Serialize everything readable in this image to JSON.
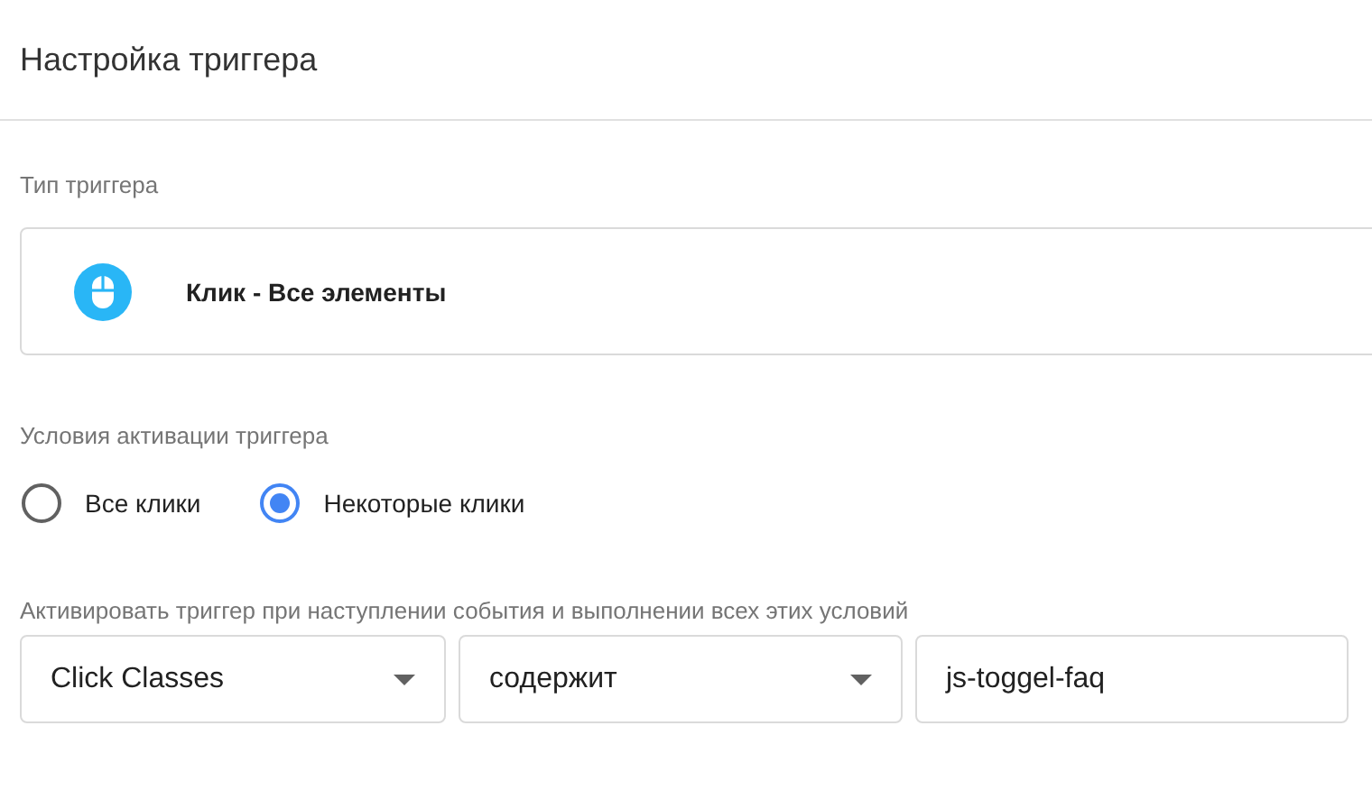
{
  "header": {
    "title": "Настройка триггера"
  },
  "trigger_type": {
    "label": "Тип триггера",
    "name": "Клик - Все элементы"
  },
  "activation": {
    "label": "Условия активации триггера",
    "options": [
      {
        "label": "Все клики",
        "selected": false
      },
      {
        "label": "Некоторые клики",
        "selected": true
      }
    ]
  },
  "conditions": {
    "label": "Активировать триггер при наступлении события и выполнении всех этих условий",
    "fields": [
      {
        "kind": "dropdown",
        "value": "Click Classes"
      },
      {
        "kind": "dropdown",
        "value": "содержит"
      },
      {
        "kind": "text",
        "value": "js-toggel-faq"
      }
    ]
  }
}
